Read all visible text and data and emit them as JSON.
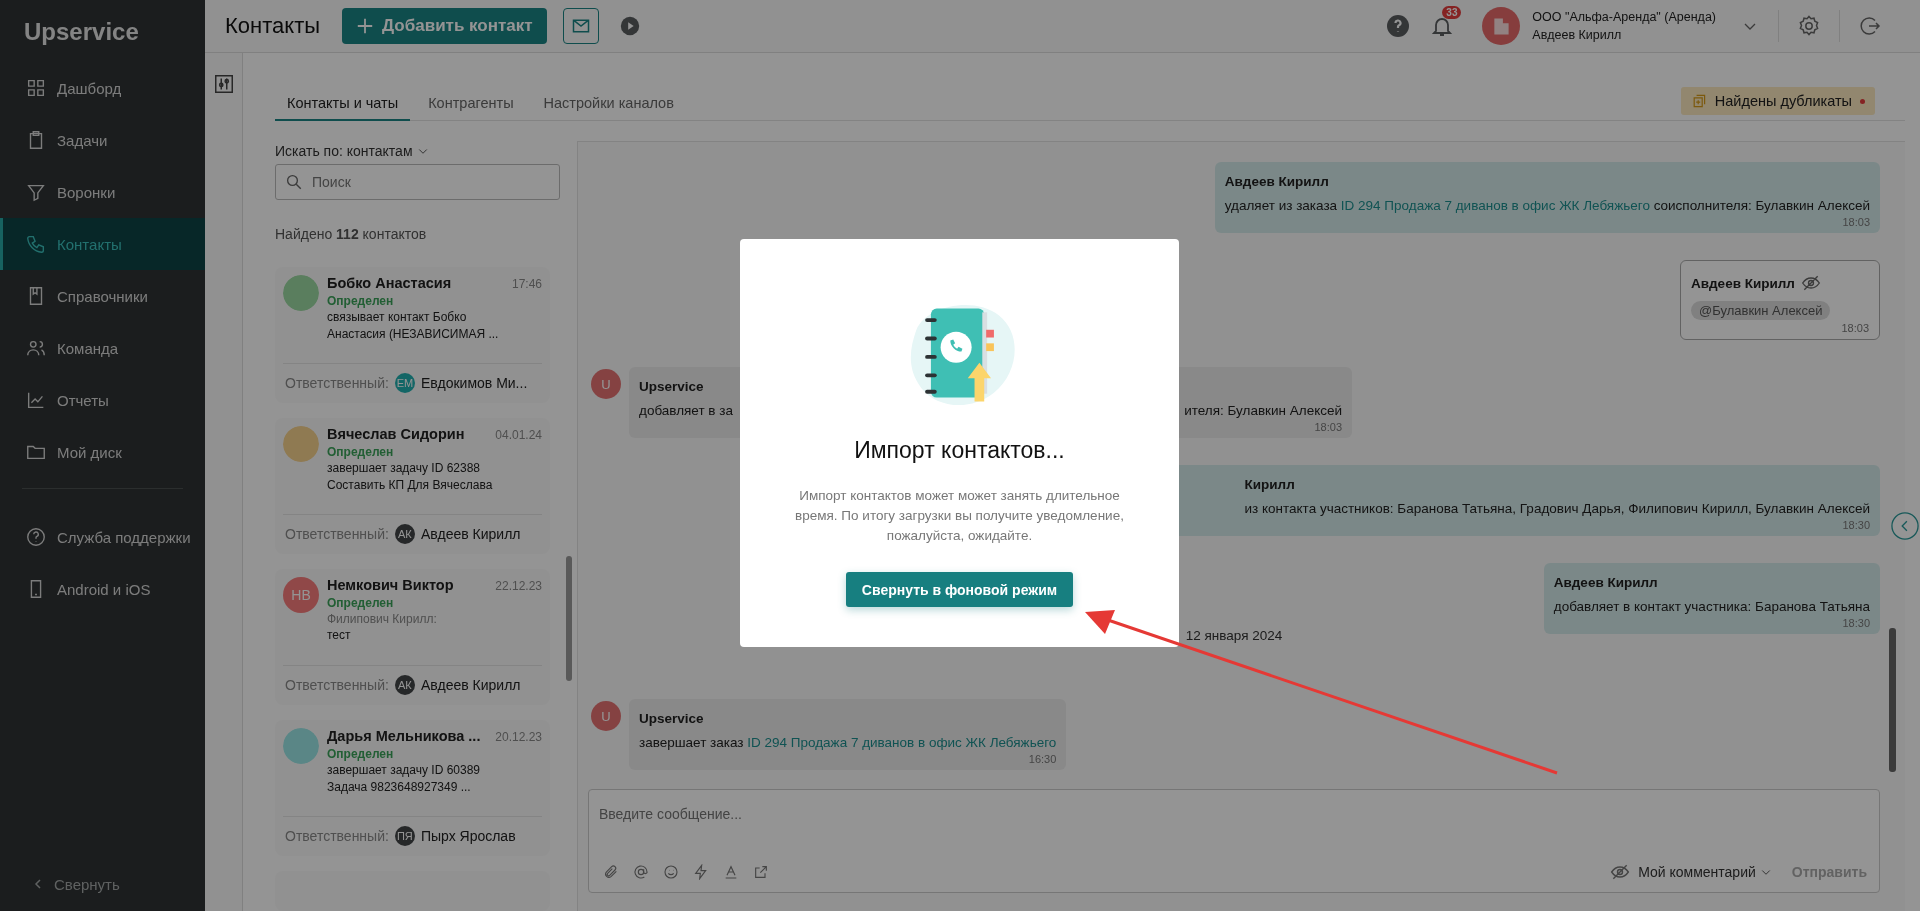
{
  "sidebar": {
    "logo": "Upservice",
    "items": [
      {
        "label": "Дашборд",
        "selected": false
      },
      {
        "label": "Задачи",
        "selected": false
      },
      {
        "label": "Воронки",
        "selected": false
      },
      {
        "label": "Контакты",
        "selected": true
      },
      {
        "label": "Справочники",
        "selected": false
      },
      {
        "label": "Команда",
        "selected": false
      },
      {
        "label": "Отчеты",
        "selected": false
      },
      {
        "label": "Мой диск",
        "selected": false
      }
    ],
    "extra_items": [
      {
        "label": "Служба поддержки",
        "selected": false
      },
      {
        "label": "Android и iOS",
        "selected": false
      }
    ],
    "collapse": "Свернуть"
  },
  "header": {
    "title": "Контакты",
    "add_button": "Добавить контакт",
    "notifications": "33",
    "company": "ООО \"Альфа-Аренда\" (Аренда)",
    "user": "Авдеев Кирилл"
  },
  "tabs": [
    {
      "label": "Контакты и чаты",
      "selected": true
    },
    {
      "label": "Контрагенты",
      "selected": false
    },
    {
      "label": "Настройки каналов",
      "selected": false
    }
  ],
  "duplicates": {
    "label": "Найдены дубликаты",
    "unread": true
  },
  "contacts": {
    "search_by": "Искать по: контактам",
    "search_placeholder": "Поиск",
    "found": "Найдено **112** контактов",
    "items": [
      {
        "name": "Бобко Анастасия",
        "time": "17:46",
        "status": "Определен",
        "preview": "связывает контакт Бобко Анастасия (НЕЗАВИСИМАЯ ...",
        "avatar": {
          "kind": "image",
          "color": "#5a7e5e"
        },
        "responsible_label": "Ответственный:",
        "responsible": {
          "initials": "ЕМ",
          "name": "Евдокимов Ми...",
          "color": "#146666"
        }
      },
      {
        "name": "Вячеслав Сидорин",
        "time": "04.01.24",
        "status": "Определен",
        "preview": "завершает задачу ID 62388 Составить КП Для Вячеслава",
        "avatar": {
          "kind": "image",
          "color": "#8f7a52"
        },
        "responsible_label": "Ответственный:",
        "responsible": {
          "initials": "АК",
          "name": "Авдеев Кирилл",
          "color": "#262829"
        }
      },
      {
        "name": "Немкович Виктор",
        "time": "22.12.23",
        "status": "Определен",
        "preview_author": "Филипович Кирилл:",
        "preview": "тест",
        "avatar": {
          "kind": "initials",
          "text": "НВ",
          "color": "#904848"
        },
        "responsible_label": "Ответственный:",
        "responsible": {
          "initials": "АК",
          "name": "Авдеев Кирилл",
          "color": "#262829"
        }
      },
      {
        "name": "Дарья Мельникова ...",
        "time": "20.12.23",
        "status": "Определен",
        "preview": "завершает задачу ID 60389 Задача 9823648927349 ...",
        "avatar": {
          "kind": "image",
          "color": "#5a8686"
        },
        "responsible_label": "Ответственный:",
        "responsible": {
          "initials": "ПЯ",
          "name": "Пырх Ярослав",
          "color": "#262829"
        }
      }
    ]
  },
  "messages": [
    {
      "kind": "event",
      "outgoing": true,
      "sender": "Авдеев Кирилл",
      "body": [
        {
          "text": "удаляет из заказа "
        },
        {
          "text": "ID 294 Продажа 7 диванов в офис ЖК Лебяжьего",
          "link": true
        },
        {
          "text": " соисполнителя: Булавкин Алексей"
        }
      ],
      "time": "18:03"
    },
    {
      "kind": "comment",
      "outgoing": true,
      "sender": "Авдеев Кирилл",
      "private": true,
      "mention": "@Булавкин Алексей",
      "time": "18:03"
    },
    {
      "kind": "partial",
      "outgoing": false,
      "avatar": "U",
      "sender": "Upservice",
      "fragments": [
        "добавляет в за",
        "ителя: Булавкин Алексей"
      ],
      "time": "18:03"
    },
    {
      "kind": "partial",
      "outgoing": true,
      "sender": "Кирилл",
      "fragments": [
        "из контакта участников: Баранова Татьяна, Градович Дарья, Филипович Кирилл, Булавкин Алексей"
      ],
      "time": "18:30"
    },
    {
      "kind": "event",
      "outgoing": true,
      "sender": "Авдеев Кирилл",
      "body": [
        {
          "text": "добавляет в контакт участника: Баранова Татьяна"
        }
      ],
      "time": "18:30"
    },
    {
      "kind": "date",
      "text": "12 января 2024"
    },
    {
      "kind": "event",
      "outgoing": false,
      "avatar": "U",
      "sender": "Upservice",
      "body": [
        {
          "text": "завершает заказ "
        },
        {
          "text": "ID 294 Продажа 7 диванов в офис ЖК Лебяжьего",
          "link": true
        }
      ],
      "time": "16:30"
    }
  ],
  "composer": {
    "placeholder": "Введите сообщение...",
    "visibility": "Мой комментарий",
    "send": "Отправить",
    "send_disabled": true
  },
  "modal": {
    "title": "Импорт контактов...",
    "text": "Импорт контактов может может занять длительное время. По итогу загрузки вы получите уведомление, пожалуйста, ожидайте.",
    "button": "Свернуть в фоновой режим"
  }
}
